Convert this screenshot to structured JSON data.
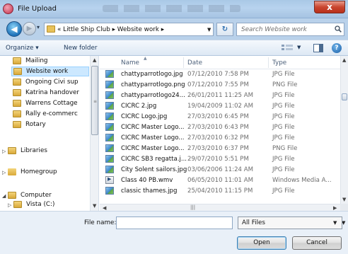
{
  "window": {
    "title": "File Upload",
    "close_label": "x"
  },
  "address": {
    "path": "« Little Ship Club ▸ Website work ▸",
    "search_placeholder": "Search Website work"
  },
  "toolbar": {
    "organize": "Organize ▾",
    "new_folder": "New folder"
  },
  "nav": {
    "folders": [
      "Mailing",
      "Website work",
      "Ongoing Civi sup",
      "Katrina handover",
      "Warrens Cottage",
      "Rally e-commerc",
      "Rotary"
    ],
    "selected": "Website work",
    "libraries": "Libraries",
    "homegroup": "Homegroup",
    "computer": "Computer",
    "vista": "Vista (C:)"
  },
  "columns": {
    "name": "Name",
    "date": "Date",
    "type": "Type"
  },
  "files": [
    {
      "name": "chattyparrotlogo.jpg",
      "date": "07/12/2010 7:58 PM",
      "type": "JPG File",
      "icon": "image-icon"
    },
    {
      "name": "chattyparrotlogo.png",
      "date": "07/12/2010 7:55 PM",
      "type": "PNG File",
      "icon": "image-icon"
    },
    {
      "name": "chattyparrotlogo24...",
      "date": "26/01/2011 11:25 AM",
      "type": "JPG File",
      "icon": "image-icon"
    },
    {
      "name": "CICRC 2.jpg",
      "date": "19/04/2009 11:02 AM",
      "type": "JPG File",
      "icon": "image-icon"
    },
    {
      "name": "CICRC Logo.jpg",
      "date": "27/03/2010 6:45 PM",
      "type": "JPG File",
      "icon": "image-icon"
    },
    {
      "name": "CICRC Master Logo...",
      "date": "27/03/2010 6:43 PM",
      "type": "JPG File",
      "icon": "image-icon"
    },
    {
      "name": "CICRC Master Logo...",
      "date": "27/03/2010 6:32 PM",
      "type": "JPG File",
      "icon": "image-icon"
    },
    {
      "name": "CICRC Master Logo...",
      "date": "27/03/2010 6:37 PM",
      "type": "PNG File",
      "icon": "image-icon"
    },
    {
      "name": "CICRC SB3 regatta.j...",
      "date": "29/07/2010 5:51 PM",
      "type": "JPG File",
      "icon": "image-icon"
    },
    {
      "name": "City Solent sailors.jpg",
      "date": "03/06/2006 11:24 AM",
      "type": "JPG File",
      "icon": "image-icon"
    },
    {
      "name": "Class 40 PB.wmv",
      "date": "06/05/2010 11:01 AM",
      "type": "Windows Media A...",
      "icon": "video-icon"
    },
    {
      "name": "classic thames.jpg",
      "date": "25/04/2010 11:15 PM",
      "type": "JPG File",
      "icon": "image-icon"
    }
  ],
  "bottom": {
    "filename_label": "File name:",
    "filename_value": "",
    "filter": "All Files",
    "open": "Open",
    "cancel": "Cancel"
  }
}
